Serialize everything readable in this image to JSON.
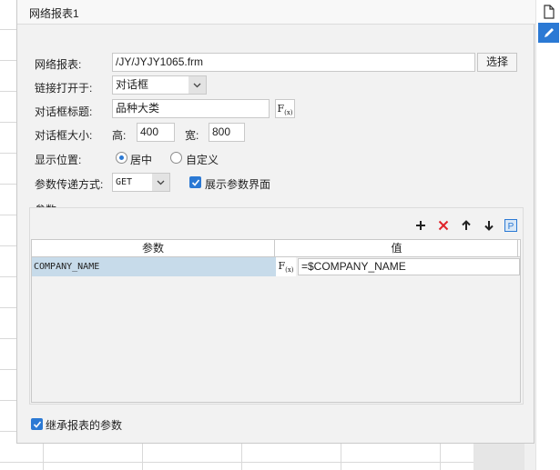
{
  "dialog": {
    "tab_title": "网络报表1"
  },
  "form": {
    "report_label": "网络报表:",
    "report_path": "/JY/JYJY1065.frm",
    "select_button": "选择",
    "open_in_label": "链接打开于:",
    "open_in_value": "对话框",
    "dialog_title_label": "对话框标题:",
    "dialog_title_value": "品种大类",
    "formula_label": "F(x)",
    "dialog_size_label": "对话框大小:",
    "height_label": "高:",
    "height_value": "400",
    "width_label": "宽:",
    "width_value": "800",
    "position_label": "显示位置:",
    "position_center": "居中",
    "position_custom": "自定义",
    "pass_method_label": "参数传递方式:",
    "pass_method_value": "GET",
    "show_params_label": "展示参数界面",
    "show_params_checked": true
  },
  "params": {
    "section_label": "参数",
    "columns": [
      "参数",
      "值"
    ],
    "rows": [
      {
        "name": "COMPANY_NAME",
        "value": "=$COMPANY_NAME"
      }
    ]
  },
  "inherit": {
    "label": "继承报表的参数",
    "checked": true
  },
  "colors": {
    "accent": "#2b79d4",
    "delete": "#e0242a",
    "selected_row": "#c7dbea",
    "dialog_bg": "#f2f2f2"
  }
}
